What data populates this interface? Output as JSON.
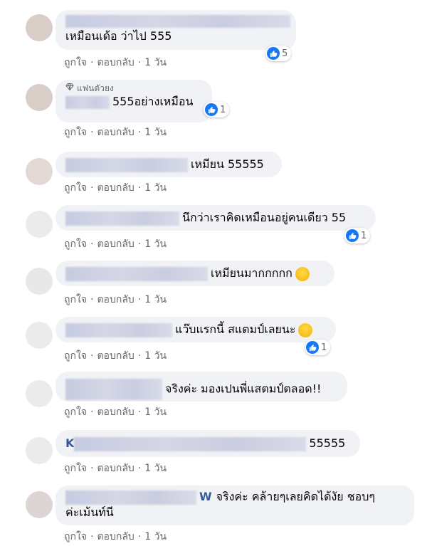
{
  "actions": {
    "like": "ถูกใจ",
    "reply": "ตอบกลับ",
    "time": "1 วัน",
    "sep": "·"
  },
  "badge": {
    "fan_label": "แฟนตัวยง"
  },
  "comments": [
    {
      "text": "เหมือนเด้อ ว่าไป 555",
      "reactions": "5"
    },
    {
      "name_partial": "",
      "text": "555อย่างเหมือน",
      "reactions": "1"
    },
    {
      "text": "เหมียน 55555"
    },
    {
      "text": "นึกว่าเราคิดเหมือนอยู่คนเดียว 55",
      "reactions": "1"
    },
    {
      "text": "เหมียนมากกกกก"
    },
    {
      "text": "แว๊บแรกนี้ สแตมป์เลยนะ",
      "reactions": "1"
    },
    {
      "text": "จริงค่ะ มองเปนพี่แสตมป์ตลอด!!"
    },
    {
      "name_partial": "K",
      "text": "55555"
    },
    {
      "name_partial": "W",
      "text_line1": "จริงค่ะ คล้ายๆเลยคิดได้งัย ชอบๆ",
      "text_line2": "ค่ะเม้นท์นี"
    }
  ],
  "colors": {
    "like_blue": "#1877f2",
    "bubble": "#f0f2f5",
    "meta_text": "#65676b"
  }
}
